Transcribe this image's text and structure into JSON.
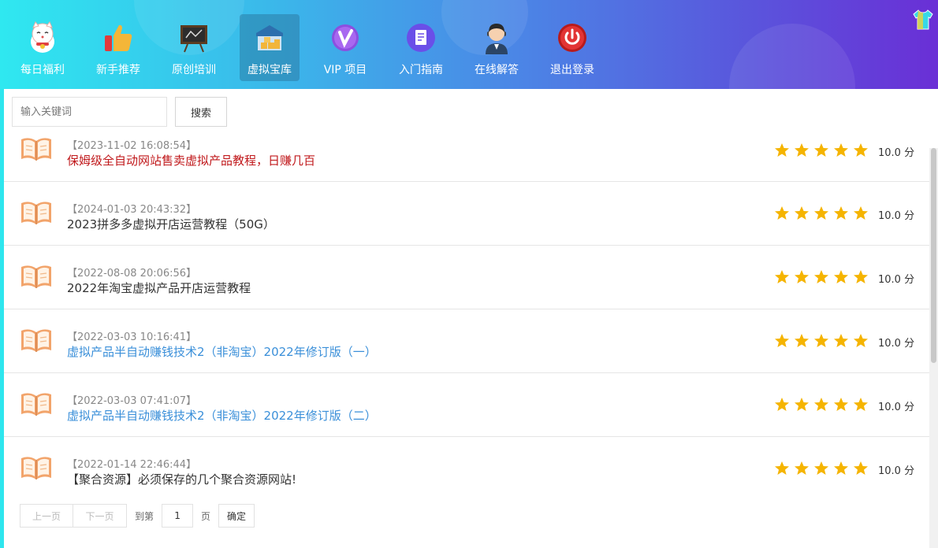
{
  "nav": {
    "items": [
      {
        "label": "每日福利",
        "icon": "lucky-cat-icon"
      },
      {
        "label": "新手推荐",
        "icon": "thumbs-up-icon"
      },
      {
        "label": "原创培训",
        "icon": "chalkboard-icon"
      },
      {
        "label": "虚拟宝库",
        "icon": "warehouse-icon",
        "active": true
      },
      {
        "label": "VIP 项目",
        "icon": "vip-icon"
      },
      {
        "label": "入门指南",
        "icon": "document-icon"
      },
      {
        "label": "在线解答",
        "icon": "support-agent-icon"
      },
      {
        "label": "退出登录",
        "icon": "power-icon"
      }
    ]
  },
  "search": {
    "placeholder": "输入关键词",
    "button": "搜索"
  },
  "list": [
    {
      "date": "【2023-11-02 16:08:54】",
      "title": "保姆级全自动网站售卖虚拟产品教程，日赚几百",
      "color": "#c0181b",
      "rating": 5,
      "score": "10.0 分"
    },
    {
      "date": "【2024-01-03 20:43:32】",
      "title": "2023拼多多虚拟开店运营教程（50G）",
      "color": "#333333",
      "rating": 5,
      "score": "10.0 分"
    },
    {
      "date": "【2022-08-08 20:06:56】",
      "title": "2022年淘宝虚拟产品开店运营教程",
      "color": "#333333",
      "rating": 5,
      "score": "10.0 分"
    },
    {
      "date": "【2022-03-03 10:16:41】",
      "title": "虚拟产品半自动赚钱技术2（非淘宝）2022年修订版（一）",
      "color": "#3a8fd9",
      "rating": 5,
      "score": "10.0 分"
    },
    {
      "date": "【2022-03-03 07:41:07】",
      "title": "虚拟产品半自动赚钱技术2（非淘宝）2022年修订版（二）",
      "color": "#3a8fd9",
      "rating": 5,
      "score": "10.0 分"
    },
    {
      "date": "【2022-01-14 22:46:44】",
      "title": "【聚合资源】必须保存的几个聚合资源网站!",
      "color": "#333333",
      "rating": 5,
      "score": "10.0 分"
    }
  ],
  "pager": {
    "prev": "上一页",
    "next": "下一页",
    "goto": "到第",
    "page": "1",
    "page_unit": "页",
    "confirm": "确定"
  },
  "colors": {
    "star": "#f5b400",
    "book": "#f2a46b"
  }
}
